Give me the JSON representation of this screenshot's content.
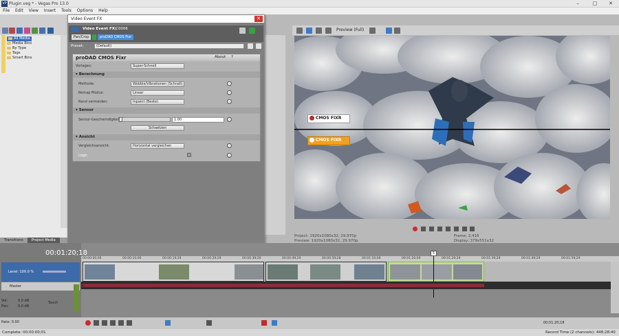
{
  "window": {
    "title": "Plugin.veg * - Vegas Pro 13.0",
    "icon": "VP"
  },
  "menu": [
    "File",
    "Edit",
    "View",
    "Insert",
    "Tools",
    "Options",
    "Help"
  ],
  "explorer": {
    "items": [
      "All Media",
      "Media Bins",
      "By Type",
      "Tags",
      "Smart Bins"
    ],
    "tabs": [
      "Transitions",
      "Project Media"
    ]
  },
  "fx": {
    "dialog_title": "Video Event FX",
    "chain_label": "Video Event FX:",
    "chain_event": "C0006",
    "chain_plugins": [
      "Pan/Crop",
      "proDAD CMOS Fixr"
    ],
    "preset_label": "Preset:",
    "preset_value": "(Default)",
    "plugin_name": "proDAD CMOS Fixr",
    "about": "About",
    "help": "?",
    "vorlagen_label": "Vorlagen:",
    "vorlagen_value": "Super-Schnell",
    "sec_berechnung": "Berechnung",
    "methode_label": "Methode:",
    "methode_value": "Wobble/Vibrationen (Schnell)",
    "remap_label": "Remap Modus:",
    "remap_value": "Linear",
    "rand_label": "Rand vermeiden:",
    "rand_value": "Inpaint (Beste)",
    "sec_sensor": "Sensor",
    "sensor_label": "Sensor-Geschwindigkeit:",
    "sensor_value": "1.00",
    "sensor_level": 0,
    "schaetzen": "Schaetzen",
    "sec_ansicht": "Ansicht",
    "vergleich_label": "Vergleichsansicht:",
    "vergleich_value": "Horizontal vergleichen",
    "logo_label": "Logo:"
  },
  "preview": {
    "mode": "Preview (Full)",
    "logo1": "CMOS FIXR",
    "logo2": "CMOS FIXR",
    "project_label": "Project:",
    "project_value": "1920x1080x32, 29.970p",
    "previewinfo_label": "Preview:",
    "previewinfo_value": "1920x1080x32, 29.970p",
    "frame_label": "Frame:",
    "frame_value": "2,416",
    "display_label": "Display:",
    "display_value": "379x551x32"
  },
  "timeline": {
    "timecode": "00:01:20;18",
    "track1_level": "Level: 100.0 %",
    "master": "Master",
    "vol_label": "Vol:",
    "vol_value": "0.0 dB",
    "pan_label": "Pan:",
    "pan_value": "0.0 dB",
    "touch": "Touch",
    "ruler": [
      "00:00:00;00",
      "00:00:10;00",
      "00:00:19;29",
      "00:00:29;29",
      "00:00:39;29",
      "00:00:49;29",
      "00:00:59;28",
      "00:01:10;00",
      "00:01:20;00",
      "00:01:29;29",
      "00:01:39;29",
      "00:01:49;29",
      "00:01:59;29"
    ],
    "rate_label": "Rate: 0.00",
    "end_time": "00:01:20;18",
    "marker": "5"
  },
  "status": {
    "left": "Complete: 00:00:00;01",
    "right": "Record Time (2 channels): 448:28:40"
  }
}
